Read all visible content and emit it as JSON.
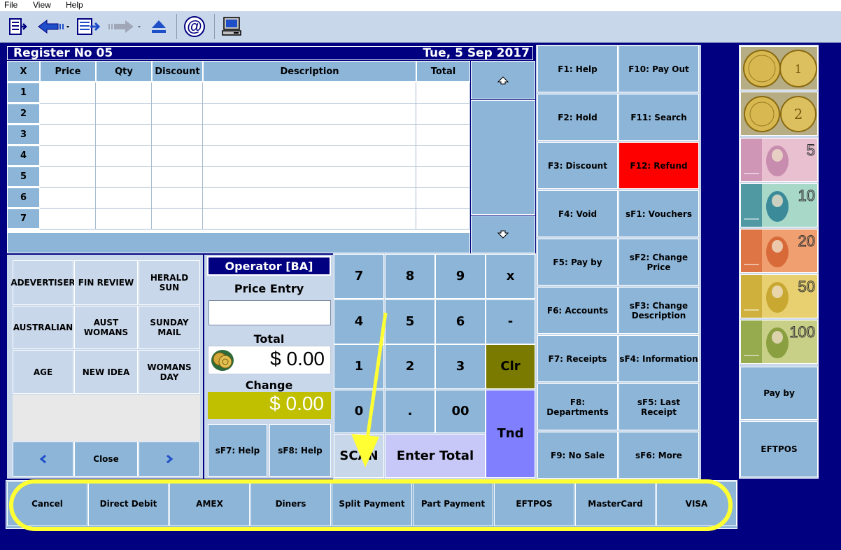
{
  "menu": {
    "file": "File",
    "view": "View",
    "help": "Help"
  },
  "register": {
    "title": "Register No 05",
    "date": "Tue, 5 Sep 2017"
  },
  "grid": {
    "columns": [
      "X",
      "Price",
      "Qty",
      "Discount",
      "Description",
      "Total"
    ],
    "rows": [
      "1",
      "2",
      "3",
      "4",
      "5",
      "6",
      "7"
    ]
  },
  "quick_items": [
    "ADEVERTISER",
    "FIN REVIEW",
    "HERALD SUN",
    "AUSTRALIAN",
    "AUST WOMANS",
    "SUNDAY MAIL",
    "AGE",
    "NEW IDEA",
    "WOMANS DAY"
  ],
  "quick_nav": {
    "close": "Close"
  },
  "operator": {
    "label": "Operator [BA]",
    "price_entry": "Price Entry",
    "price_value": "",
    "total_label": "Total",
    "total_value": "$ 0.00",
    "change_label": "Change",
    "change_value": "$ 0.00",
    "sf7": "sF7: Help",
    "sf8": "sF8: Help"
  },
  "keypad": {
    "k7": "7",
    "k8": "8",
    "k9": "9",
    "kx": "x",
    "k4": "4",
    "k5": "5",
    "k6": "6",
    "kminus": "-",
    "k1": "1",
    "k2": "2",
    "k3": "3",
    "clr": "Clr",
    "k0": "0",
    "kdot": ".",
    "k00": "00",
    "scan": "SCAN",
    "enter_total": "Enter Total",
    "tnd": "Tnd"
  },
  "function_keys": [
    "F1: Help",
    "F10: Pay Out",
    "F2: Hold",
    "F11: Search",
    "F3: Discount",
    "F12: Refund",
    "F4: Void",
    "sF1: Vouchers",
    "F5: Pay by",
    "sF2: Change Price",
    "F6: Accounts",
    "sF3: Change Description",
    "F7: Receipts",
    "sF4: Information",
    "F8: Departments",
    "sF5: Last Receipt",
    "F9: No Sale",
    "sF6: More"
  ],
  "money": {
    "pay_by": "Pay by",
    "eftpos": "EFTPOS",
    "notes": [
      "5",
      "10",
      "20",
      "50",
      "100"
    ]
  },
  "payment_methods": [
    "Cancel",
    "Direct Debit",
    "AMEX",
    "Diners",
    "Split Payment",
    "Part Payment",
    "EFTPOS",
    "MasterCard",
    "VISA"
  ],
  "colors": {
    "button": "#8cb5d8",
    "header": "#000080",
    "refund": "#ff0000",
    "clr": "#7a7a00",
    "enter_total": "#c8c8f8",
    "tnd": "#8080ff",
    "change_bg": "#c0c000",
    "highlight": "#ffff33"
  }
}
